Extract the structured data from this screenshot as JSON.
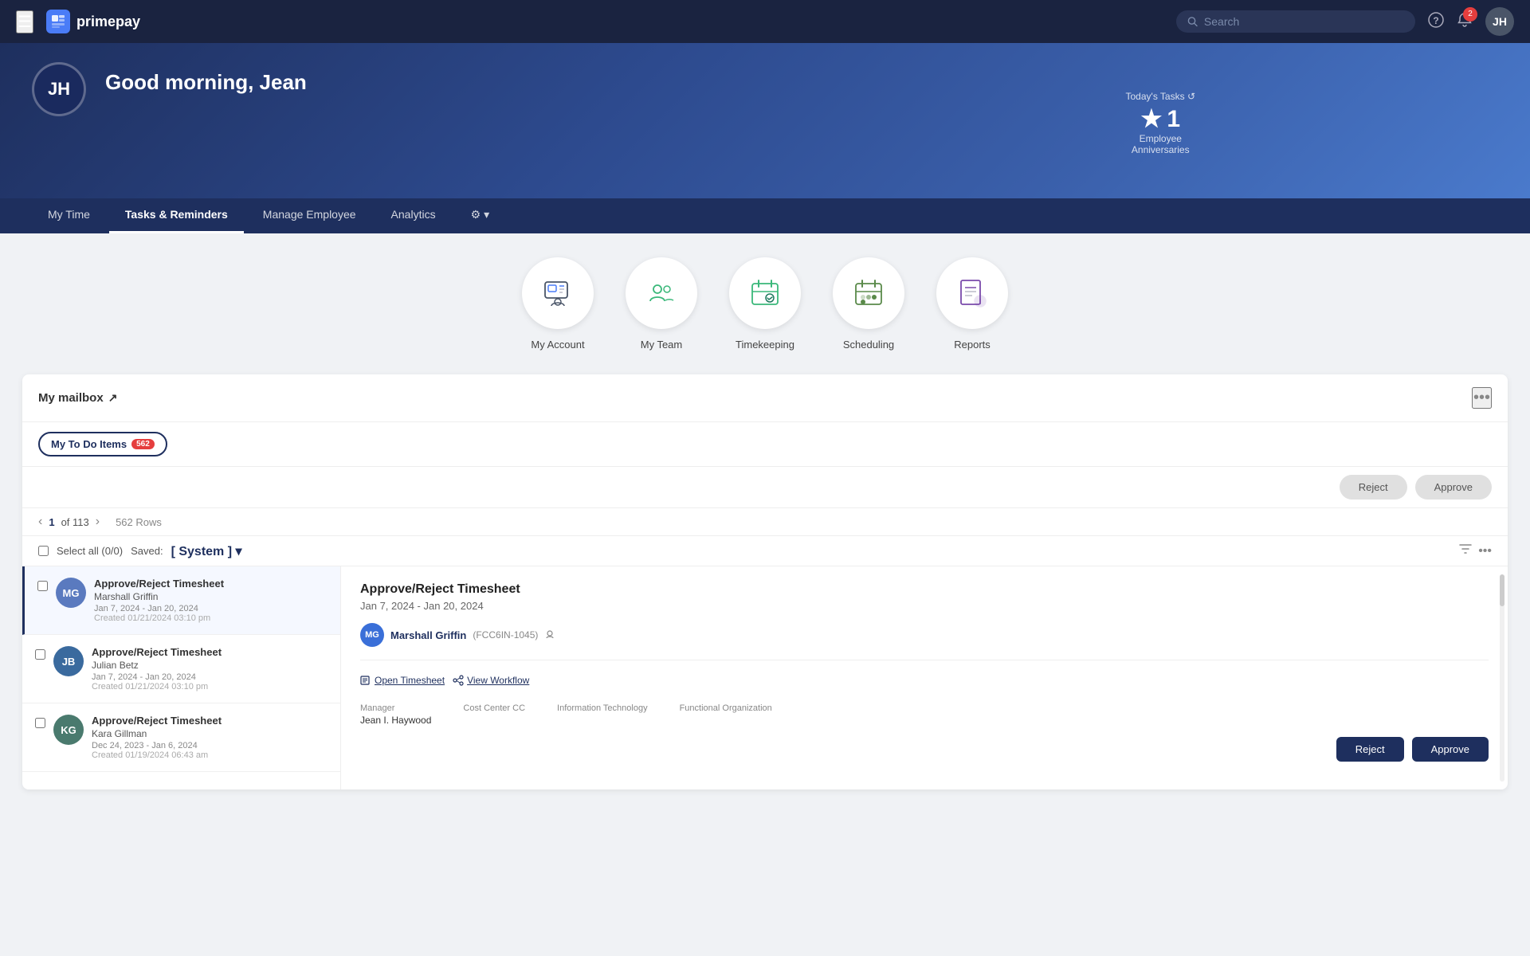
{
  "brand": {
    "logo_icon": "p",
    "logo_text": "primepay",
    "logo_icon_symbol": "🅟"
  },
  "topnav": {
    "hamburger": "☰",
    "search_placeholder": "Search",
    "help_icon": "?",
    "notification_count": "2",
    "avatar_initials": "JH"
  },
  "hero": {
    "avatar_initials": "JH",
    "greeting": "Good morning, Jean",
    "tasks_today_label": "Today's Tasks ↺",
    "tasks_count": "1",
    "tasks_star": "★",
    "tasks_sub1": "Employee",
    "tasks_sub2": "Anniversaries"
  },
  "nav_tabs": [
    {
      "label": "My Time",
      "active": false
    },
    {
      "label": "Tasks & Reminders",
      "active": true
    },
    {
      "label": "Manage Employee",
      "active": false
    },
    {
      "label": "Analytics",
      "active": false
    },
    {
      "label": "⚙ ▾",
      "active": false,
      "is_gear": true
    }
  ],
  "quick_links": [
    {
      "icon": "🪪",
      "label": "My Account",
      "color": "#4a7cf7"
    },
    {
      "icon": "👥",
      "label": "My Team",
      "color": "#3ab87a"
    },
    {
      "icon": "🖥️",
      "label": "Timekeeping",
      "color": "#3ab87a"
    },
    {
      "icon": "📅",
      "label": "Scheduling",
      "color": "#5a8a4a"
    },
    {
      "icon": "📊",
      "label": "Reports",
      "color": "#7a4aab"
    }
  ],
  "mailbox": {
    "title": "My mailbox",
    "link_icon": "↗",
    "tab_label": "My To Do Items",
    "tab_count": "562",
    "reject_label": "Reject",
    "approve_label": "Approve",
    "page_current": "1",
    "page_total": "of 113",
    "rows_count": "562 Rows",
    "select_all_label": "Select all (0/0)",
    "saved_label": "Saved:",
    "saved_system": "[ System ]",
    "list_items": [
      {
        "initials": "MG",
        "bg_color": "#5a7abf",
        "title": "Approve/Reject Timesheet",
        "name": "Marshall Griffin",
        "date_range": "Jan 7, 2024 - Jan 20, 2024",
        "created": "Created 01/21/2024 03:10 pm",
        "selected": true
      },
      {
        "initials": "JB",
        "bg_color": "#3a6a9e",
        "title": "Approve/Reject Timesheet",
        "name": "Julian Betz",
        "date_range": "Jan 7, 2024 - Jan 20, 2024",
        "created": "Created 01/21/2024 03:10 pm",
        "selected": false
      },
      {
        "initials": "KG",
        "bg_color": "#4a7a6e",
        "title": "Approve/Reject Timesheet",
        "name": "Kara Gillman",
        "date_range": "Dec 24, 2023 - Jan 6, 2024",
        "created": "Created 01/19/2024 06:43 am",
        "selected": false
      }
    ],
    "detail": {
      "title": "Approve/Reject Timesheet",
      "date_range": "Jan 7, 2024 - Jan 20, 2024",
      "person_initials": "MG",
      "person_name": "Marshall Griffin",
      "person_id": "(FCC6IN-1045)",
      "open_timesheet_label": "Open Timesheet",
      "view_workflow_label": "View Workflow",
      "meta": [
        {
          "label": "Manager",
          "value": "Jean I. Haywood"
        },
        {
          "label": "Cost Center CC",
          "value": ""
        },
        {
          "label": "Information Technology",
          "value": ""
        },
        {
          "label": "Functional Organization",
          "value": ""
        }
      ],
      "reject_label": "Reject",
      "approve_label": "Approve"
    }
  }
}
